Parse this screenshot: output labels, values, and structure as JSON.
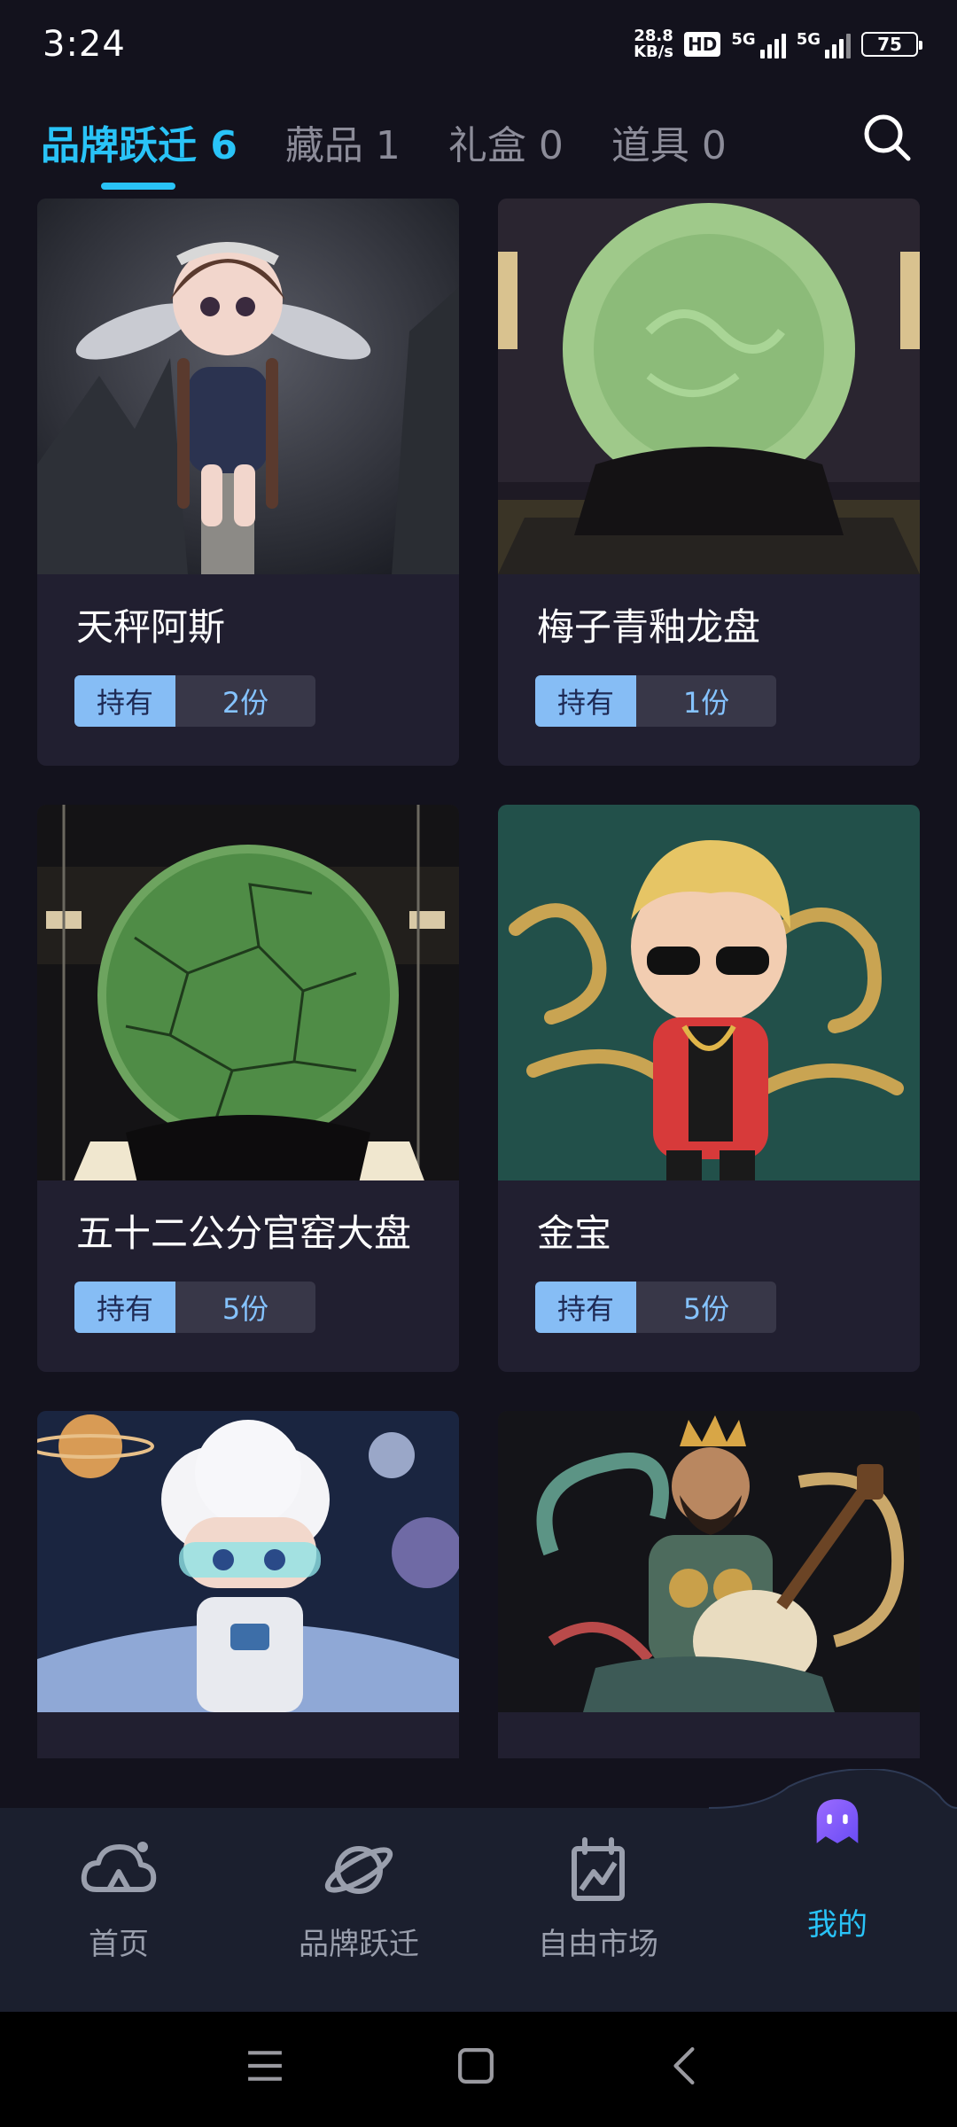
{
  "status_bar": {
    "time": "3:24",
    "net_speed_value": "28.8",
    "net_speed_unit": "KB/s",
    "hd": "HD",
    "signal_1": "5G",
    "signal_2": "5G",
    "battery": "75"
  },
  "tabs": [
    {
      "label": "品牌跃迁 6",
      "active": true
    },
    {
      "label": "藏品 1",
      "active": false
    },
    {
      "label": "礼盒 0",
      "active": false
    },
    {
      "label": "道具 0",
      "active": false
    }
  ],
  "cards": [
    {
      "name": "天秤阿斯",
      "hold_label": "持有",
      "count": "2份",
      "image": "doll-with-wings-icon"
    },
    {
      "name": "梅子青釉龙盘",
      "hold_label": "持有",
      "count": "1份",
      "image": "green-dragon-plate-icon"
    },
    {
      "name": "五十二公分官窑大盘",
      "hold_label": "持有",
      "count": "5份",
      "image": "crackle-plate-icon"
    },
    {
      "name": "金宝",
      "hold_label": "持有",
      "count": "5份",
      "image": "boy-sunglasses-icon"
    },
    {
      "name": "",
      "hold_label": "",
      "count": "",
      "image": "cloud-astronaut-icon"
    },
    {
      "name": "",
      "hold_label": "",
      "count": "",
      "image": "warrior-pipa-icon"
    }
  ],
  "bottom_nav": [
    {
      "label": "首页",
      "icon": "cloud-home-icon",
      "active": false
    },
    {
      "label": "品牌跃迁",
      "icon": "planet-icon",
      "active": false
    },
    {
      "label": "自由市场",
      "icon": "market-icon",
      "active": false
    },
    {
      "label": "我的",
      "icon": "ghost-avatar-icon",
      "active": true
    }
  ],
  "colors": {
    "accent": "#29c3f7",
    "background": "#13121d",
    "card": "#211f30",
    "hold_label_bg": "#86bdf5"
  }
}
